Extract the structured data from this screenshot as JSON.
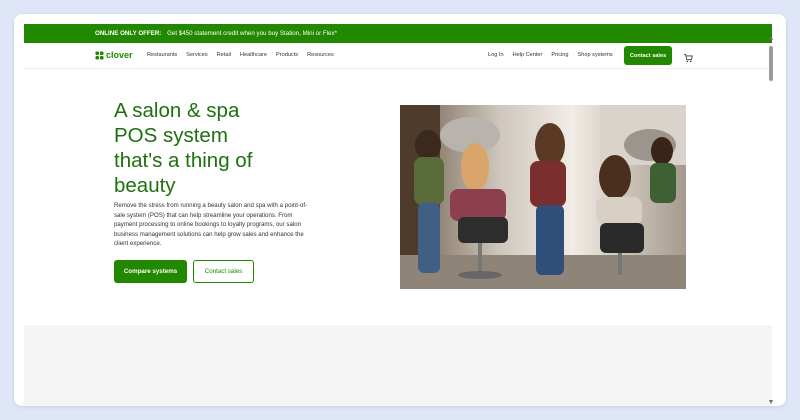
{
  "promo": {
    "bold": "ONLINE ONLY OFFER:",
    "text": "Get $450 statement credit when you buy Station, Mini or Flex*"
  },
  "nav": {
    "logo_text": "clover",
    "links": [
      "Restaurants",
      "Services",
      "Retail",
      "Healthcare",
      "Products",
      "Resources"
    ],
    "right_links": [
      "Log In",
      "Help Center",
      "Pricing",
      "Shop systems"
    ],
    "contact_label": "Contact sales",
    "cart_icon": "cart-icon"
  },
  "hero": {
    "title_lines": [
      "A salon & spa",
      "POS system",
      "that's a thing of",
      "beauty"
    ],
    "description": "Remove the stress from running a beauty salon and spa with a point-of-sale system (POS) that can help streamline your operations. From payment processing to online bookings to loyalty programs, our salon business management solutions can help grow sales and enhance the client experience.",
    "primary_button": "Compare systems",
    "secondary_button": "Contact sales"
  },
  "colors": {
    "brand_green": "#228800",
    "title_green": "#1f6f0f",
    "background": "#dfe6f7"
  }
}
